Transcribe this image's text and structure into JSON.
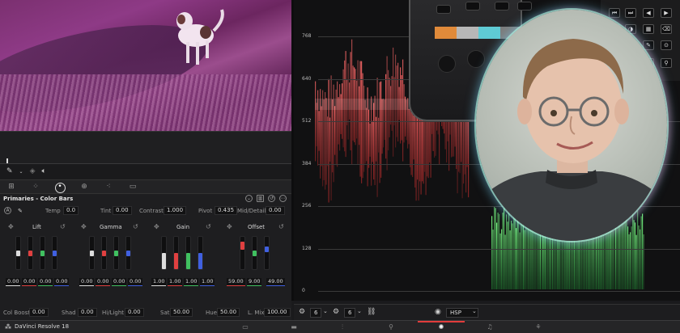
{
  "app": {
    "name": "DaVinci Resolve 18"
  },
  "panel": {
    "title": "Primaries - Color Bars",
    "params": {
      "temp_label": "Temp",
      "temp": "0.0",
      "tint_label": "Tint",
      "tint": "0.00",
      "contrast_label": "Contrast",
      "contrast": "1.000",
      "pivot_label": "Pivot",
      "pivot": "0.435",
      "middetail_label": "Mid/Detail",
      "middetail": "0.00"
    },
    "wheels": [
      {
        "name": "Lift",
        "values": [
          "0.00",
          "0.00",
          "0.00",
          "0.00"
        ]
      },
      {
        "name": "Gamma",
        "values": [
          "0.00",
          "0.00",
          "0.00",
          "0.00"
        ]
      },
      {
        "name": "Gain",
        "values": [
          "1.00",
          "1.00",
          "1.00",
          "1.00"
        ]
      },
      {
        "name": "Offset",
        "values": [
          "59.00",
          "9.00",
          "49.00"
        ]
      }
    ],
    "bottom": {
      "colboost_label": "Col Boost",
      "colboost": "0.00",
      "shad_label": "Shad",
      "shad": "0.00",
      "hilight_label": "Hi/Light",
      "hilight": "0.00",
      "sat_label": "Sat",
      "sat": "50.00",
      "hue_label": "Hue",
      "hue": "50.00",
      "lmix_label": "L. Mix",
      "lmix": "100.00"
    }
  },
  "scope": {
    "ticks": [
      "768",
      "640",
      "512",
      "384",
      "256",
      "128",
      "0"
    ],
    "toolbar": {
      "sel1": "6",
      "sel2": "6",
      "colorspace": "HSP"
    }
  },
  "colors": {
    "red": "#e04040",
    "green": "#40c060",
    "blue": "#4060e0",
    "accent": "#e23c3c"
  }
}
